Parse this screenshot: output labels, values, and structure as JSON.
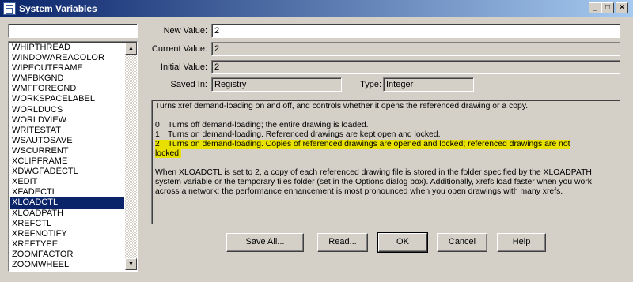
{
  "window": {
    "title": "System Variables",
    "minimize": "_",
    "maximize": "□",
    "close": "×"
  },
  "list": {
    "search_value": "",
    "items": [
      "WHIPTHREAD",
      "WINDOWAREACOLOR",
      "WIPEOUTFRAME",
      "WMFBKGND",
      "WMFFOREGND",
      "WORKSPACELABEL",
      "WORLDUCS",
      "WORLDVIEW",
      "WRITESTAT",
      "WSAUTOSAVE",
      "WSCURRENT",
      "XCLIPFRAME",
      "XDWGFADECTL",
      "XEDIT",
      "XFADECTL",
      "XLOADCTL",
      "XLOADPATH",
      "XREFCTL",
      "XREFNOTIFY",
      "XREFTYPE",
      "ZOOMFACTOR",
      "ZOOMWHEEL"
    ],
    "selected": "XLOADCTL",
    "scroll_up": "▲",
    "scroll_down": "▼"
  },
  "fields": {
    "new_value_label": "New Value:",
    "new_value": "2",
    "current_value_label": "Current Value:",
    "current_value": "2",
    "initial_value_label": "Initial Value:",
    "initial_value": "2",
    "saved_in_label": "Saved In:",
    "saved_in": "Registry",
    "type_label": "Type:",
    "type": "Integer"
  },
  "description": {
    "intro": "Turns xref demand-loading on and off, and controls whether it opens the referenced drawing or a copy.",
    "options": [
      {
        "num": "0",
        "text": "Turns off demand-loading; the entire drawing is loaded."
      },
      {
        "num": "1",
        "text": "Turns on demand-loading. Referenced drawings are kept open and locked."
      },
      {
        "num": "2",
        "text": "Turns on demand-loading. Copies of referenced drawings are opened and locked; referenced drawings are not",
        "continuation": "locked."
      }
    ],
    "highlight_color": "#e8e000",
    "detail": "When XLOADCTL is set to 2, a copy of each referenced drawing file is stored in the folder specified by the XLOADPATH system variable or the temporary files folder (set in the Options dialog box). Additionally, xrefs load faster when you work across a network: the performance enhancement is most pronounced when you open drawings with many xrefs."
  },
  "buttons": {
    "save_all": "Save All...",
    "read": "Read...",
    "ok": "OK",
    "cancel": "Cancel",
    "help": "Help"
  }
}
